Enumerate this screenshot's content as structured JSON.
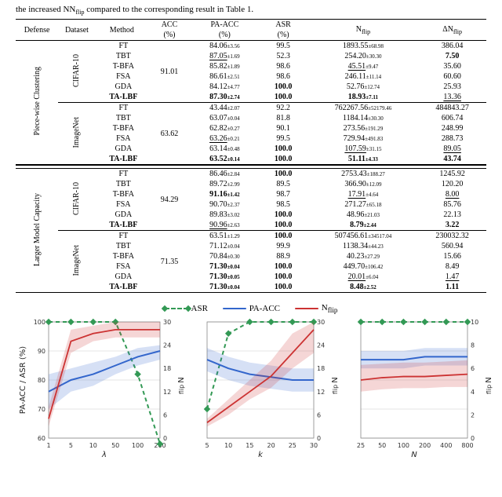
{
  "caption_prefix": "the increased N",
  "caption_sub": "flip",
  "caption_suffix": " compared to the corresponding result in Table 1.",
  "headers": {
    "defense": "Defense",
    "dataset": "Dataset",
    "method": "Method",
    "acc1": "ACC",
    "acc2": "(%)",
    "pa1": "PA-ACC",
    "pa2": "(%)",
    "asr1": "ASR",
    "asr2": "(%)",
    "nflip": "Nflip",
    "dnflip": "ΔNflip"
  },
  "defenses": [
    "Piece-wise Clustering",
    "Larger Model Capacity"
  ],
  "datasets": [
    "CIFAR-10",
    "ImageNet"
  ],
  "methods": [
    "FT",
    "TBT",
    "T-BFA",
    "FSA",
    "GDA",
    "TA-LBF"
  ],
  "blocks": [
    {
      "defense_idx": 0,
      "dataset_idx": 0,
      "acc": "91.01",
      "rows": [
        {
          "pa": "84.06",
          "pas": "±3.56",
          "asr": "99.5",
          "nf": "1893.55",
          "nfs": "±68.98",
          "dn": "386.04"
        },
        {
          "pa": "87.05",
          "pas": "±1.69",
          "asr": "52.3",
          "nf": "254.20",
          "nfs": "±30.30",
          "dn": "7.50",
          "pa_u": true,
          "dn_b": true
        },
        {
          "pa": "85.82",
          "pas": "±1.89",
          "asr": "98.6",
          "nf": "45.51",
          "nfs": "±9.47",
          "dn": "35.60",
          "nf_u": true
        },
        {
          "pa": "86.61",
          "pas": "±2.51",
          "asr": "98.6",
          "nf": "246.11",
          "nfs": "±11.14",
          "dn": "60.60"
        },
        {
          "pa": "84.12",
          "pas": "±4.77",
          "asr": "100.0",
          "nf": "52.76",
          "nfs": "±12.74",
          "dn": "25.93",
          "asr_b": true
        },
        {
          "pa": "87.30",
          "pas": "±2.74",
          "asr": "100.0",
          "nf": "18.93",
          "nfs": "±7.11",
          "dn": "13.36",
          "pa_b": true,
          "pas_b": true,
          "asr_b": true,
          "nf_b": true,
          "nfs_b": true,
          "dn_u": true
        }
      ]
    },
    {
      "defense_idx": 0,
      "dataset_idx": 1,
      "acc": "63.62",
      "rows": [
        {
          "pa": "43.44",
          "pas": "±2.07",
          "asr": "92.2",
          "nf": "762267.56",
          "nfs": "±52179.46",
          "dn": "484843.27"
        },
        {
          "pa": "63.07",
          "pas": "±0.04",
          "asr": "81.8",
          "nf": "1184.14",
          "nfs": "±30.30",
          "dn": "606.74"
        },
        {
          "pa": "62.82",
          "pas": "±0.27",
          "asr": "90.1",
          "nf": "273.56",
          "nfs": "±191.29",
          "dn": "248.99"
        },
        {
          "pa": "63.26",
          "pas": "±0.21",
          "asr": "99.5",
          "nf": "729.94",
          "nfs": "±491.83",
          "dn": "288.73",
          "pa_u": true
        },
        {
          "pa": "63.14",
          "pas": "±0.48",
          "asr": "100.0",
          "nf": "107.59",
          "nfs": "±31.15",
          "dn": "89.05",
          "asr_b": true,
          "nf_u": true,
          "dn_u": true
        },
        {
          "pa": "63.52",
          "pas": "±0.14",
          "asr": "100.0",
          "nf": "51.11",
          "nfs": "±4.33",
          "dn": "43.74",
          "pa_b": true,
          "pas_b": true,
          "asr_b": true,
          "nf_b": true,
          "nfs_b": true,
          "dn_b": true
        }
      ]
    },
    {
      "defense_idx": 1,
      "dataset_idx": 0,
      "acc": "94.29",
      "rows": [
        {
          "pa": "86.46",
          "pas": "±2.84",
          "asr": "100.0",
          "nf": "2753.43",
          "nfs": "±188.27",
          "dn": "1245.92",
          "asr_b": true
        },
        {
          "pa": "89.72",
          "pas": "±2.99",
          "asr": "89.5",
          "nf": "366.90",
          "nfs": "±12.09",
          "dn": "120.20"
        },
        {
          "pa": "91.16",
          "pas": "±1.42",
          "asr": "98.7",
          "nf": "17.91",
          "nfs": "±4.64",
          "dn": "8.00",
          "pa_b": true,
          "pas_b": true,
          "nf_u": true,
          "dn_u": true
        },
        {
          "pa": "90.70",
          "pas": "±2.37",
          "asr": "98.5",
          "nf": "271.27",
          "nfs": "±65.18",
          "dn": "85.76"
        },
        {
          "pa": "89.83",
          "pas": "±3.02",
          "asr": "100.0",
          "nf": "48.96",
          "nfs": "±21.03",
          "dn": "22.13",
          "asr_b": true
        },
        {
          "pa": "90.96",
          "pas": "±2.63",
          "asr": "100.0",
          "nf": "8.79",
          "nfs": "±2.44",
          "dn": "3.22",
          "pa_u": true,
          "asr_b": true,
          "nf_b": true,
          "nfs_b": true,
          "dn_b": true
        }
      ]
    },
    {
      "defense_idx": 1,
      "dataset_idx": 1,
      "acc": "71.35",
      "rows": [
        {
          "pa": "63.51",
          "pas": "±1.29",
          "asr": "100.0",
          "nf": "507456.61",
          "nfs": "±34517.04",
          "dn": "230032.32",
          "asr_b": true
        },
        {
          "pa": "71.12",
          "pas": "±0.04",
          "asr": "99.9",
          "nf": "1138.34",
          "nfs": "±44.23",
          "dn": "560.94"
        },
        {
          "pa": "70.84",
          "pas": "±0.30",
          "asr": "88.9",
          "nf": "40.23",
          "nfs": "±27.29",
          "dn": "15.66"
        },
        {
          "pa": "71.30",
          "pas": "±0.04",
          "asr": "100.0",
          "nf": "449.70",
          "nfs": "±106.42",
          "dn": "8.49",
          "pa_b": true,
          "pas_b": true,
          "asr_b": true
        },
        {
          "pa": "71.30",
          "pas": "±0.05",
          "asr": "100.0",
          "nf": "20.01",
          "nfs": "±6.04",
          "dn": "1.47",
          "pa_b": true,
          "pas_b": true,
          "asr_b": true,
          "nf_u": true,
          "dn_u": true
        },
        {
          "pa": "71.30",
          "pas": "±0.04",
          "asr": "100.0",
          "nf": "8.48",
          "nfs": "±2.52",
          "dn": "1.11",
          "pa_b": true,
          "pas_b": true,
          "asr_b": true,
          "nf_b": true,
          "nfs_b": true,
          "dn_b": true
        }
      ]
    }
  ],
  "legend": {
    "asr": "ASR",
    "pa": "PA-ACC",
    "nf_pre": "N",
    "nf_sub": "flip"
  },
  "chart_data": [
    {
      "id": "lambda",
      "type": "line",
      "xlabel": "λ",
      "ylabel_left": "PA-ACC / ASR (%)",
      "ylabel_right": "Nflip",
      "x": [
        1,
        5,
        10,
        50,
        100,
        200
      ],
      "left_ylim": [
        60,
        100
      ],
      "right_ylim": [
        0,
        30
      ],
      "series": [
        {
          "name": "ASR",
          "axis": "left",
          "values": [
            100,
            100,
            100,
            100,
            82,
            58
          ]
        },
        {
          "name": "PA-ACC",
          "axis": "left",
          "values": [
            76,
            80,
            82,
            85,
            88,
            90
          ],
          "band": [
            [
              70,
              82
            ],
            [
              76,
              84
            ],
            [
              78,
              86
            ],
            [
              82,
              88
            ],
            [
              85,
              91
            ],
            [
              87,
              92
            ]
          ]
        },
        {
          "name": "Nflip",
          "axis": "right",
          "values": [
            5,
            25,
            27,
            28,
            28,
            28
          ],
          "band": [
            [
              3,
              8
            ],
            [
              22,
              28
            ],
            [
              25,
              29
            ],
            [
              26,
              30
            ],
            [
              26,
              30
            ],
            [
              26,
              30
            ]
          ]
        }
      ]
    },
    {
      "id": "k",
      "type": "line",
      "xlabel": "k",
      "ylabel_right": "Nflip",
      "x": [
        5,
        10,
        15,
        20,
        25,
        30
      ],
      "left_ylim": [
        60,
        100
      ],
      "right_ylim": [
        0,
        30
      ],
      "series": [
        {
          "name": "ASR",
          "axis": "left",
          "values": [
            70,
            96,
            100,
            100,
            100,
            100
          ]
        },
        {
          "name": "PA-ACC",
          "axis": "left",
          "values": [
            87,
            84,
            82,
            81,
            80,
            80
          ],
          "band": [
            [
              83,
              91
            ],
            [
              80,
              88
            ],
            [
              78,
              86
            ],
            [
              77,
              85
            ],
            [
              76,
              84
            ],
            [
              76,
              84
            ]
          ]
        },
        {
          "name": "Nflip",
          "axis": "right",
          "values": [
            4,
            8,
            12,
            16,
            22,
            28
          ],
          "band": [
            [
              3,
              5
            ],
            [
              6,
              10
            ],
            [
              10,
              15
            ],
            [
              13,
              20
            ],
            [
              18,
              27
            ],
            [
              22,
              30
            ]
          ]
        }
      ]
    },
    {
      "id": "N",
      "type": "line",
      "xlabel": "N",
      "ylabel_right": "Nflip",
      "x": [
        25,
        50,
        100,
        200,
        400,
        800
      ],
      "left_ylim": [
        60,
        100
      ],
      "right_ylim": [
        0,
        10
      ],
      "series": [
        {
          "name": "ASR",
          "axis": "left",
          "values": [
            100,
            100,
            100,
            100,
            100,
            100
          ]
        },
        {
          "name": "PA-ACC",
          "axis": "left",
          "values": [
            87,
            87,
            87,
            88,
            88,
            88
          ],
          "band": [
            [
              84,
              90
            ],
            [
              84,
              90
            ],
            [
              84,
              90
            ],
            [
              85,
              91
            ],
            [
              85,
              91
            ],
            [
              85,
              91
            ]
          ]
        },
        {
          "name": "Nflip",
          "axis": "right",
          "values": [
            5.0,
            5.2,
            5.3,
            5.3,
            5.4,
            5.5
          ],
          "band": [
            [
              4,
              6.3
            ],
            [
              4.2,
              6.4
            ],
            [
              4.3,
              6.5
            ],
            [
              4.3,
              6.5
            ],
            [
              4.4,
              6.6
            ],
            [
              4.4,
              6.7
            ]
          ]
        }
      ]
    }
  ]
}
